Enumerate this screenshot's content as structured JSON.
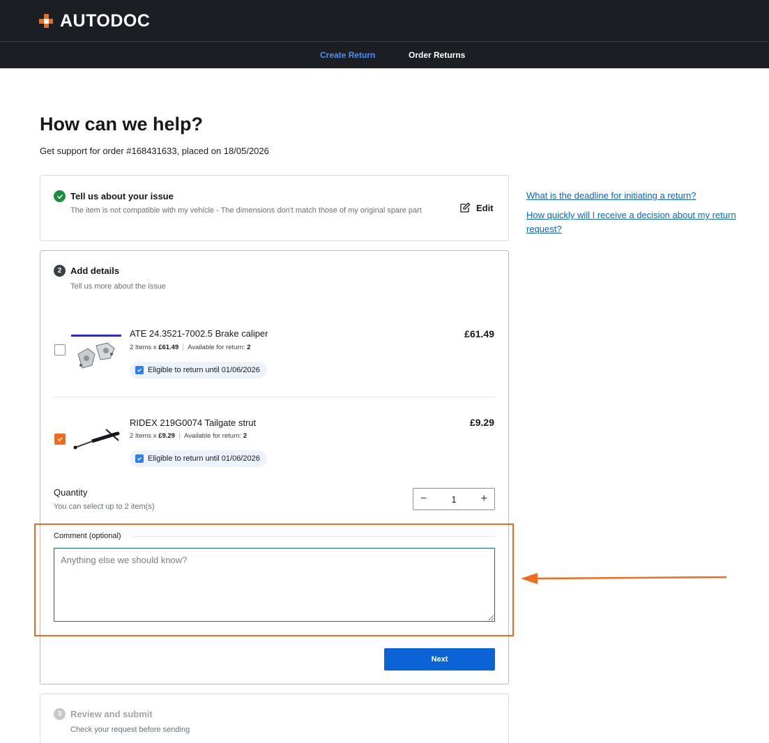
{
  "brand": {
    "name": "AUTODOC"
  },
  "nav": {
    "tabs": [
      {
        "label": "Create Return",
        "active": true
      },
      {
        "label": "Order Returns",
        "active": false
      }
    ]
  },
  "page": {
    "title": "How can we help?",
    "subtitle": "Get support for order #168431633, placed on 18/05/2026"
  },
  "steps": {
    "issue": {
      "title": "Tell us about your issue",
      "description": "The item is not compatible with my vehicle - The dimensions don't match those of my original spare part",
      "edit_label": "Edit"
    },
    "details": {
      "number": "2",
      "title": "Add details",
      "description": "Tell us more about the issue"
    },
    "review": {
      "number": "3",
      "title": "Review and submit",
      "description": "Check your request before sending"
    }
  },
  "products": [
    {
      "name": "ATE 24.3521-7002.5 Brake caliper",
      "qty_text": "2 Items x ",
      "unit_price": "£61.49",
      "available_label": "Available for return: ",
      "available_count": "2",
      "price": "£61.49",
      "eligible_text": "Eligible to return until 01/06/2026",
      "checked": false
    },
    {
      "name": "RIDEX 219G0074 Tailgate strut",
      "qty_text": "2 Items x ",
      "unit_price": "£9.29",
      "available_label": "Available for return: ",
      "available_count": "2",
      "price": "£9.29",
      "eligible_text": "Eligible to return until 01/06/2026",
      "checked": true
    }
  ],
  "quantity": {
    "label": "Quantity",
    "hint": "You can select up to 2 item(s)",
    "value": "1",
    "minus": "−",
    "plus": "+"
  },
  "comment": {
    "label": "Comment (optional)",
    "placeholder": "Anything else we should know?",
    "value": ""
  },
  "next_button": {
    "label": "Next"
  },
  "faq": [
    {
      "label": "What is the deadline for initiating a return?"
    },
    {
      "label": "How quickly will I receive a decision about my return request?"
    }
  ],
  "colors": {
    "accent": "#f26a1b",
    "primary": "#0b63d6",
    "header_bg": "#1b1f23",
    "success": "#1e8e3e"
  }
}
